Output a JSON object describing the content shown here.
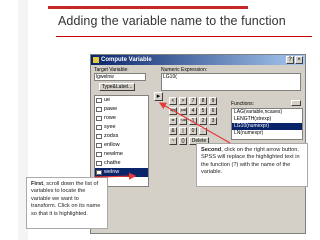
{
  "slide": {
    "title": "Adding the variable name to the function"
  },
  "dialog": {
    "title": "Compute Variable",
    "target_variable_label": "Target Variable:",
    "target_variable_value": "lgwelnw",
    "type_label_button": "Type&Label...",
    "numeric_expression_label": "Numeric Expression:",
    "numeric_expression_value": "LG10(",
    "functions_label": "Functions:",
    "variables": [
      "ue",
      "pawe",
      "rowe",
      "syee",
      "zodss",
      "enllow",
      "newlme",
      "chathe",
      "welnw"
    ],
    "selected_variable_index": 8,
    "functions": [
      "LAG(variable,ncases)",
      "LENGTH(strexp)",
      "LG10(numexpr)",
      "LN(numexpr)"
    ],
    "selected_function_index": 2,
    "keypad": [
      [
        "<",
        ">",
        "7",
        "8",
        "9"
      ],
      [
        "<=",
        ">=",
        "4",
        "5",
        "6"
      ],
      [
        "=",
        "~=",
        "1",
        "2",
        "3"
      ],
      [
        "&",
        "|",
        "0",
        "."
      ],
      [
        "~",
        "()",
        "Delete"
      ]
    ],
    "arrow_glyph": "▸"
  },
  "callouts": {
    "first_bold": "First",
    "first_text": ", scroll down the list of variables to locate the variable we want to transform.  Click on its name so that it is highlighted.",
    "second_bold": "Second",
    "second_text": ", click on the right arrow button.  SPSS will replace the highlighted text in the function (?) with the name of the variable."
  },
  "colors": {
    "accent_red": "#c62828",
    "highlight": "#0a246a",
    "callout_arrow": "#e53935"
  },
  "icons": {
    "close": "close-icon",
    "help": "help-icon",
    "variable": "numeric-variable-icon",
    "dialog": "calculator-icon"
  }
}
